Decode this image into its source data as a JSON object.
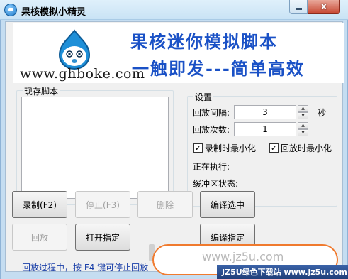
{
  "window": {
    "title": "果核模拟小精灵",
    "min_label": "",
    "close_label": "x"
  },
  "banner": {
    "slogan_line1": "果核迷你模拟脚本",
    "slogan_line2": "一触即发---简单高效",
    "site_url": "www.ghboke.com",
    "slogan_color": "#1a51c6"
  },
  "script_panel": {
    "legend": "现存脚本",
    "items": []
  },
  "settings": {
    "legend": "设置",
    "interval_label": "回放间隔:",
    "interval_value": "3",
    "interval_unit": "秒",
    "count_label": "回放次数:",
    "count_value": "1",
    "record_minimize_label": "录制时最小化",
    "record_minimize_checked": true,
    "playback_minimize_label": "回放时最小化",
    "playback_minimize_checked": true,
    "executing_label": "正在执行:",
    "buffer_label": "缓冲区状态:"
  },
  "buttons": {
    "record": "录制(F2)",
    "stop": "停止(F3)",
    "delete": "删除",
    "compile_selected": "编译选中",
    "playback": "回放",
    "open_specified": "打开指定",
    "compile_specified": "编译指定"
  },
  "status_text": "回放过程中，按 F4 键可停止回放",
  "watermark": {
    "url": "www.jz5u.com",
    "bar_text": "JZ5U绿色下载站 www.jz5u.com",
    "oval_color": "#f07a2e",
    "bar_color": "#2b4f91"
  }
}
